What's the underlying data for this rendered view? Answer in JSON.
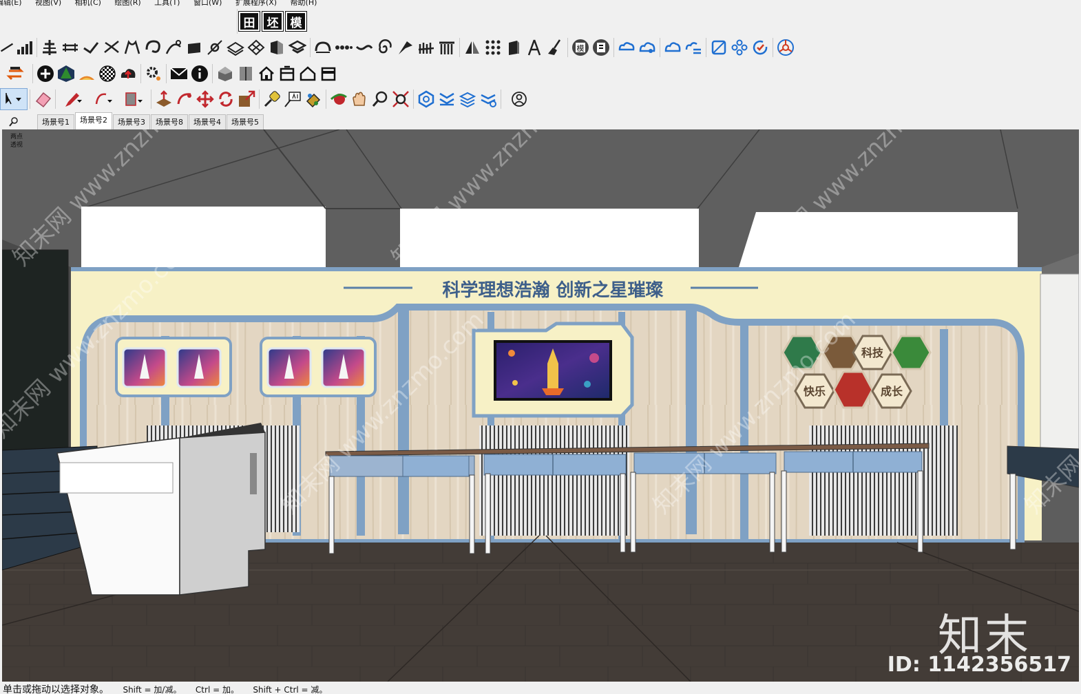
{
  "menu": {
    "items": [
      "编辑(E)",
      "视图(V)",
      "相机(C)",
      "绘图(R)",
      "工具(T)",
      "窗口(W)",
      "扩展程序(X)",
      "帮助(H)"
    ]
  },
  "plugin_badges": [
    "田",
    "坯",
    "模"
  ],
  "toolbar_badge_text": "模",
  "scene_tabs": {
    "search_icon": "magnifier-icon",
    "tabs": [
      "场景号1",
      "场景号2",
      "场景号3",
      "场景号8",
      "场景号4",
      "场景号5"
    ],
    "active_index": 1
  },
  "viewport": {
    "camera_label_line1": "两点",
    "camera_label_line2": "透视",
    "banner_title": "科学理想浩瀚 创新之星璀璨",
    "hex_labels": [
      "科技",
      "快乐",
      "成长"
    ],
    "colors": {
      "wall": "#f7f1c6",
      "accent_blue": "#7fa1c4",
      "floor": "#3f3935",
      "ceiling": "#5d5d5d"
    }
  },
  "watermark": {
    "site_text": "知末网 www.znzmo.com",
    "brand": "知末",
    "id_text": "ID: 1142356517"
  },
  "status_bar": {
    "main": "单击或拖动以选择对象。",
    "hint1": "Shift = 加/减。",
    "hint2": "Ctrl = 加。",
    "hint3": "Shift + Ctrl = 减。"
  }
}
